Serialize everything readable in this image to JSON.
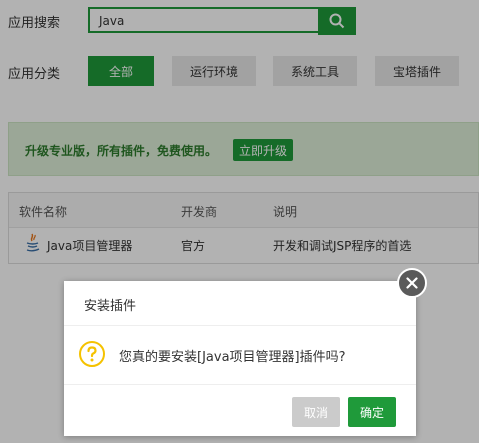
{
  "search": {
    "label": "应用搜索",
    "value": "Java"
  },
  "category": {
    "label": "应用分类",
    "items": [
      "全部",
      "运行环境",
      "系统工具",
      "宝塔插件"
    ]
  },
  "banner": {
    "text": "升级专业版，所有插件，免费使用。",
    "button": "立即升级"
  },
  "table": {
    "headers": [
      "软件名称",
      "开发商",
      "说明"
    ],
    "rows": [
      {
        "name": "Java项目管理器",
        "developer": "官方",
        "description": "开发和调试JSP程序的首选"
      }
    ]
  },
  "dialog": {
    "title": "安装插件",
    "message": "您真的要安装[Java项目管理器]插件吗?",
    "cancel": "取消",
    "confirm": "确定"
  },
  "colors": {
    "accent": "#1f9a3a",
    "warning": "#f5c200"
  }
}
